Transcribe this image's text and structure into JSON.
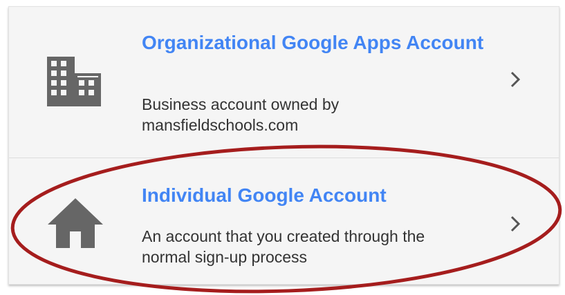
{
  "options": [
    {
      "title": "Organizational Google Apps Account",
      "description": "Business account owned by mansfieldschools.com",
      "icon": "building-icon"
    },
    {
      "title": "Individual Google Account",
      "description": "An account that you created through the normal sign-up process",
      "icon": "home-icon"
    }
  ],
  "colors": {
    "title": "#4285f4",
    "description": "#333333",
    "icon": "#666666",
    "card_background": "#f5f5f5",
    "annotation_ellipse": "#a51d1d"
  }
}
